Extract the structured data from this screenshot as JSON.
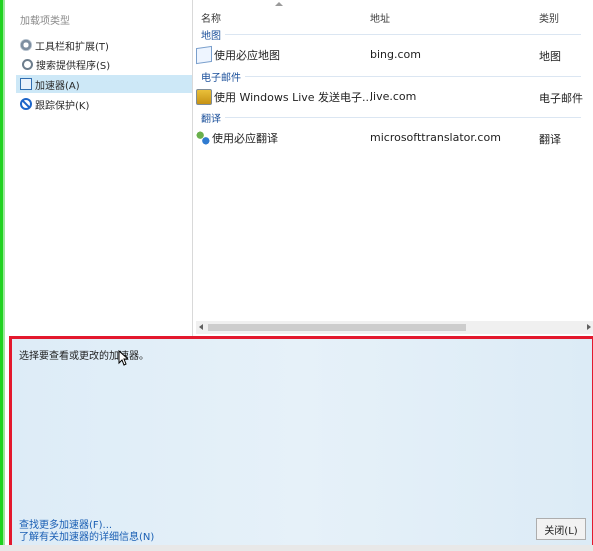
{
  "sidebar": {
    "header": "加载项类型",
    "items": [
      {
        "label": "工具栏和扩展(T)",
        "icon": "gear-icon"
      },
      {
        "label": "搜索提供程序(S)",
        "icon": "search-icon"
      },
      {
        "label": "加速器(A)",
        "icon": "accelerator-icon",
        "selected": true
      },
      {
        "label": "跟踪保护(K)",
        "icon": "block-icon"
      }
    ]
  },
  "list": {
    "columns": [
      "名称",
      "地址",
      "类别"
    ],
    "groups": [
      {
        "name": "地图",
        "rows": [
          {
            "name": "使用必应地图",
            "address": "bing.com",
            "category": "地图",
            "icon": "map-icon"
          }
        ]
      },
      {
        "name": "电子邮件",
        "rows": [
          {
            "name": "使用 Windows Live 发送电子...",
            "address": "live.com",
            "category": "电子邮件",
            "icon": "mail-icon"
          }
        ]
      },
      {
        "name": "翻译",
        "rows": [
          {
            "name": "使用必应翻译",
            "address": "microsofttranslator.com",
            "category": "翻译",
            "icon": "translate-icon"
          }
        ]
      }
    ]
  },
  "details": {
    "description": "选择要查看或更改的加速器。",
    "find_more_link": "查找更多加速器(F)...",
    "learn_more_link": "了解有关加速器的详细信息(N)",
    "close_button": "关闭(L)"
  },
  "colors": {
    "highlight_border": "#e3182d",
    "selection": "#cde8f7",
    "link": "#1a5fb4",
    "panel_bg": "#ddecf7"
  }
}
